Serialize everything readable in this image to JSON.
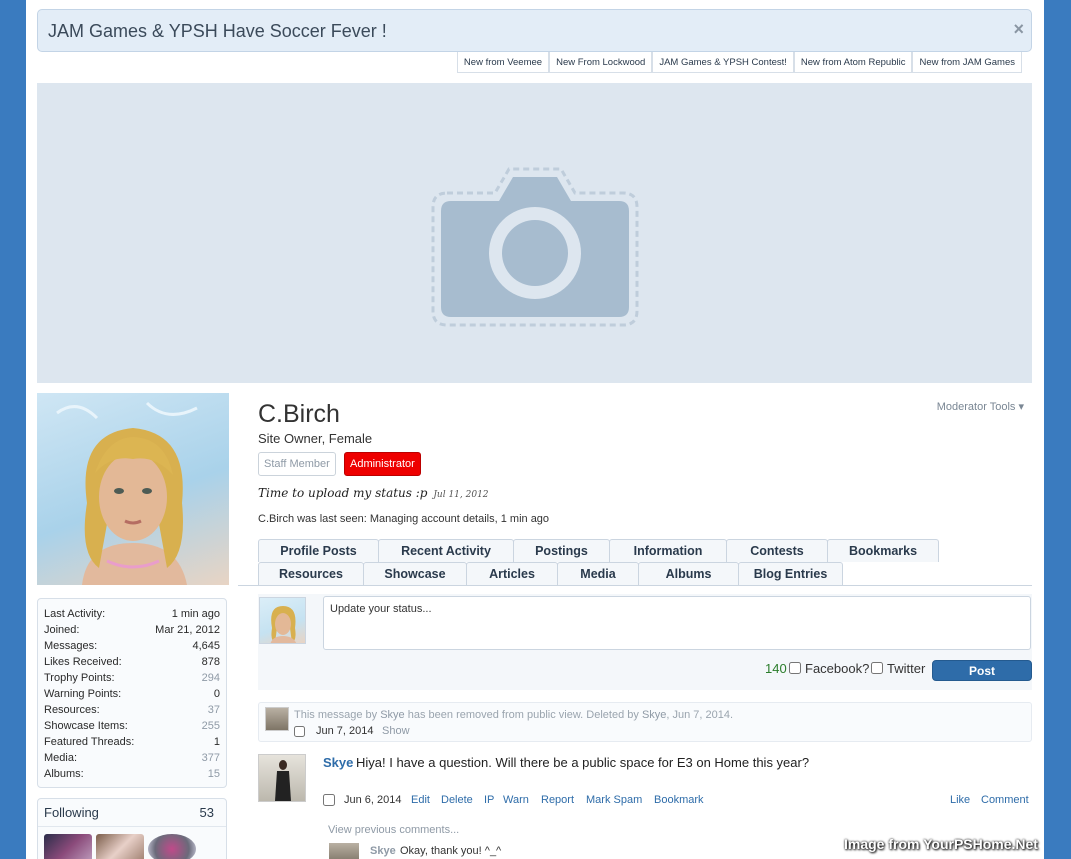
{
  "notice": {
    "title": "JAM Games & YPSH Have Soccer Fever !",
    "close": "×",
    "tabs": [
      "New from Veemee",
      "New From Lockwood",
      "JAM Games & YPSH Contest!",
      "New from Atom Republic",
      "New from JAM Games"
    ]
  },
  "cover": {
    "icon": "camera-icon"
  },
  "profile": {
    "username": "C.Birch",
    "user_title": "Site Owner, Female",
    "banners": [
      "Staff Member",
      "Administrator"
    ],
    "status": "Time to upload my status :p",
    "status_date": "Jul 11, 2012",
    "last_seen": "C.Birch was last seen: Managing account details, 1 min ago",
    "moderator_tools": "Moderator Tools ▾"
  },
  "stats": [
    {
      "label": "Last Activity:",
      "value": "1 min ago"
    },
    {
      "label": "Joined:",
      "value": "Mar 21, 2012"
    },
    {
      "label": "Messages:",
      "value": "4,645"
    },
    {
      "label": "Likes Received:",
      "value": "878"
    },
    {
      "label": "Trophy Points:",
      "value": "294"
    },
    {
      "label": "Warning Points:",
      "value": "0"
    },
    {
      "label": "Resources:",
      "value": "37"
    },
    {
      "label": "Showcase Items:",
      "value": "255"
    },
    {
      "label": "Featured Threads:",
      "value": "1"
    },
    {
      "label": "Media:",
      "value": "377"
    },
    {
      "label": "Albums:",
      "value": "15"
    }
  ],
  "following": {
    "label": "Following",
    "count": "53"
  },
  "tabs_row1": [
    "Profile Posts",
    "Recent Activity",
    "Postings",
    "Information",
    "Contests",
    "Bookmarks"
  ],
  "tabs_row2": [
    "Resources",
    "Showcase",
    "Articles",
    "Media",
    "Albums",
    "Blog Entries"
  ],
  "compose": {
    "placeholder": "Update your status...",
    "counter": "140",
    "facebook": "Facebook?",
    "twitter": "Twitter",
    "post": "Post"
  },
  "deleted_message": {
    "prefix": "This message by",
    "author": "Skye",
    "middle": "has been removed from public view. Deleted by",
    "deleter": "Skye",
    "suffix": ", Jun 7, 2014.",
    "date": "Jun 7, 2014",
    "show": "Show"
  },
  "post": {
    "author": "Skye",
    "text": "Hiya! I have a question. Will there be a public space for E3 on Home this year?",
    "date": "Jun 6, 2014",
    "actions": [
      "Edit",
      "Delete",
      "IP",
      "Warn",
      "Report",
      "Mark Spam",
      "Bookmark"
    ],
    "like": "Like",
    "comment": "Comment",
    "view_previous": "View previous comments...",
    "comment_author": "Skye",
    "comment_text": "Okay, thank you! ^_^"
  },
  "watermark": "Image from YourPSHome.Net"
}
